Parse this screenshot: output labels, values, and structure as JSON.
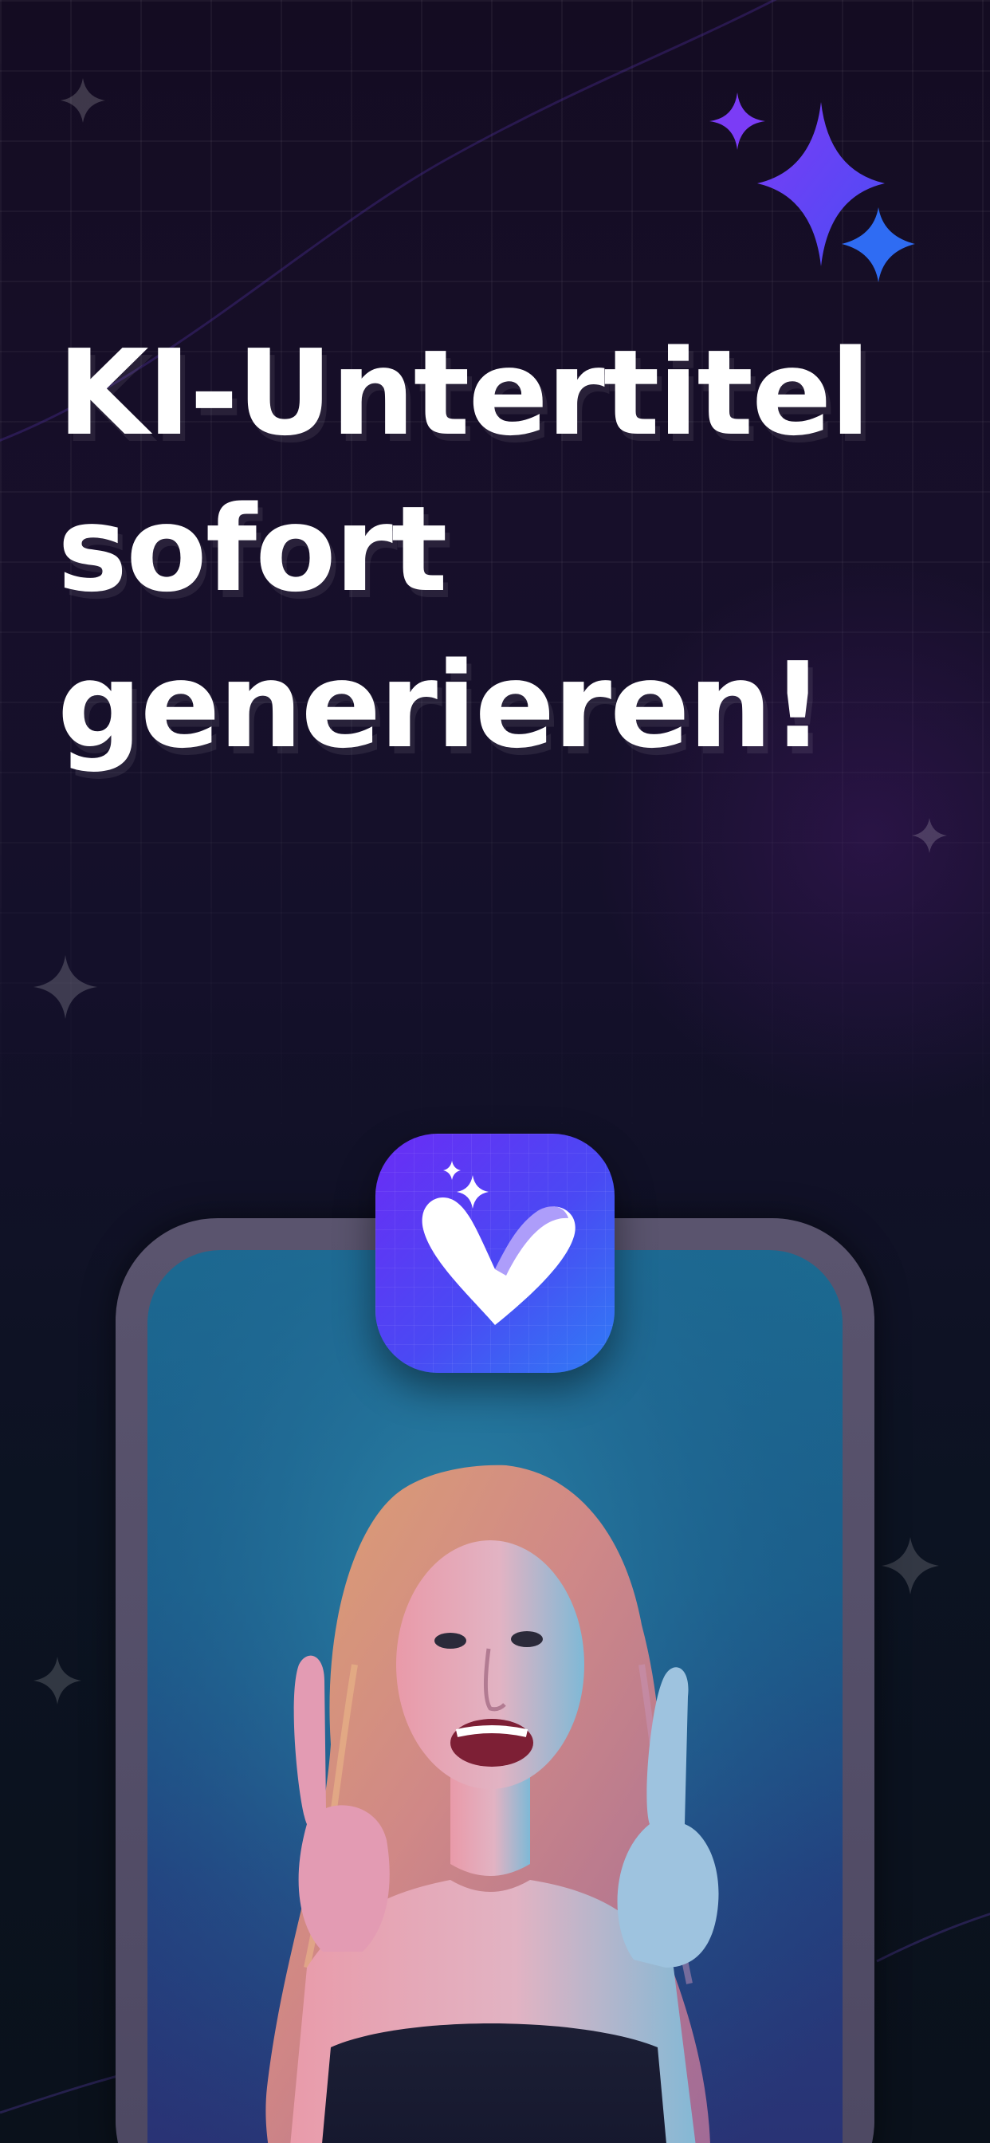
{
  "headline": {
    "line1": "KI-Untertitel",
    "line2": "sofort",
    "line3": "generieren!"
  },
  "colors": {
    "background": "#140c22",
    "accent_purple": "#7b3cf6",
    "accent_blue": "#2f6cf3",
    "app_icon_gradient_start": "#6a2cf5",
    "app_icon_gradient_end": "#2f7df5",
    "headline": "#ffffff"
  },
  "icons": {
    "app_icon": "heart-v-sparkle-icon",
    "big_sparkle": "sparkle-icon",
    "background_stars": "four-point-star-icon"
  }
}
